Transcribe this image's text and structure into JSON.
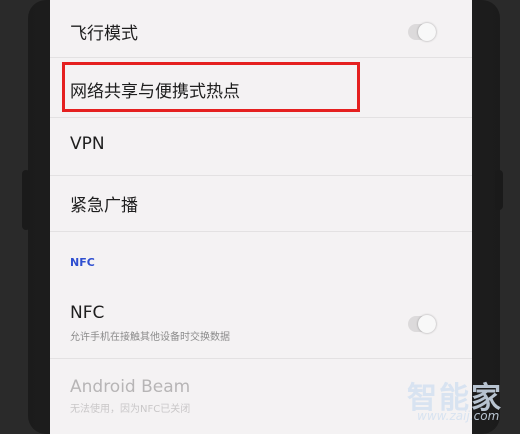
{
  "settings": {
    "airplane_mode": {
      "label": "飞行模式",
      "toggle": "off"
    },
    "hotspot": {
      "label": "网络共享与便携式热点"
    },
    "vpn": {
      "label": "VPN"
    },
    "emergency_broadcast": {
      "label": "紧急广播"
    },
    "nfc_section": {
      "header": "NFC"
    },
    "nfc": {
      "label": "NFC",
      "description": "允许手机在接触其他设备时交换数据",
      "toggle": "off"
    },
    "android_beam": {
      "label": "Android Beam",
      "description": "无法使用，因为NFC已关闭"
    }
  },
  "watermark": {
    "logo": "智能家",
    "url": "www.zaij.com"
  },
  "colors": {
    "highlight": "#e52020",
    "section_header": "#2f4fd0",
    "screen_bg": "#f4f2f3"
  }
}
